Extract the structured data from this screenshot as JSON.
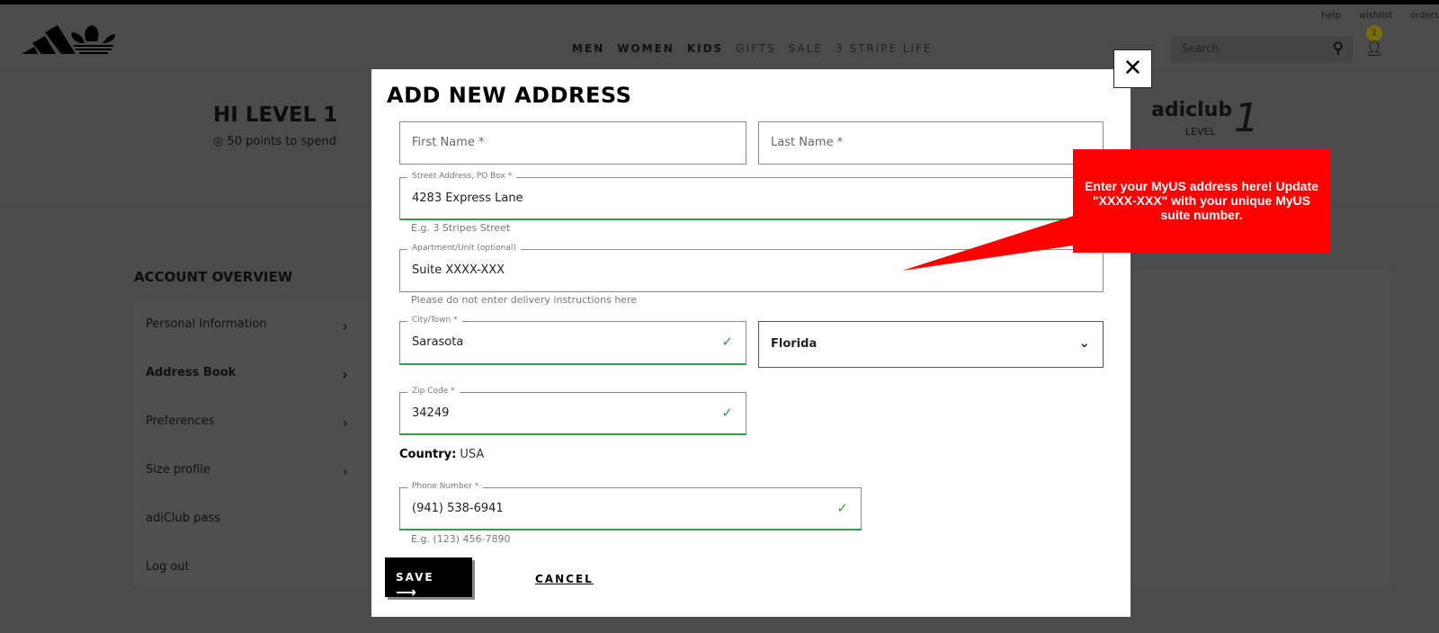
{
  "header": {
    "utility_links": [
      "help",
      "wishlist",
      "orders"
    ],
    "nav": [
      {
        "label": "MEN",
        "bold": true
      },
      {
        "label": "WOMEN",
        "bold": true
      },
      {
        "label": "KIDS",
        "bold": true
      },
      {
        "label": "GIFTS",
        "bold": false
      },
      {
        "label": "SALE",
        "bold": false
      },
      {
        "label": "3 STRIPE LIFE",
        "bold": false
      }
    ],
    "search_placeholder": "Search",
    "cart_badge": "1"
  },
  "profile": {
    "greeting": "HI LEVEL 1",
    "points": "50 points to spend",
    "club_brand": "adiclub",
    "club_level_label": "LEVEL",
    "club_level": "1"
  },
  "sidebar": {
    "title": "ACCOUNT OVERVIEW",
    "items": [
      "Personal Information",
      "Address Book",
      "Preferences",
      "Size profile",
      "adiClub pass",
      "Log out"
    ]
  },
  "modal": {
    "title": "ADD NEW ADDRESS",
    "first_name_placeholder": "First Name *",
    "last_name_placeholder": "Last Name *",
    "street_label": "Street Address, PO Box *",
    "street_value": "4283 Express Lane",
    "street_hint": "E.g. 3 Stripes Street",
    "apt_label": "Apartment/Unit (optional)",
    "apt_value": "Suite XXXX-XXX",
    "apt_hint": "Please do not enter delivery instructions here",
    "city_label": "City/Town *",
    "city_value": "Sarasota",
    "state_value": "Florida",
    "zip_label": "Zip Code *",
    "zip_value": "34249",
    "country_label": "Country:",
    "country_value": "USA",
    "phone_label": "Phone Number *",
    "phone_value": "(941) 538-6941",
    "phone_hint": "E.g. (123) 456-7890",
    "save_label": "SAVE",
    "cancel_label": "CANCEL"
  },
  "callout": {
    "text": "Enter your MyUS address here! Update \"XXXX-XXX\" with your unique MyUS suite number.",
    "color": "#ff0000"
  },
  "colors": {
    "valid": "#2e9e46",
    "overlay": "#4b4b4b"
  }
}
